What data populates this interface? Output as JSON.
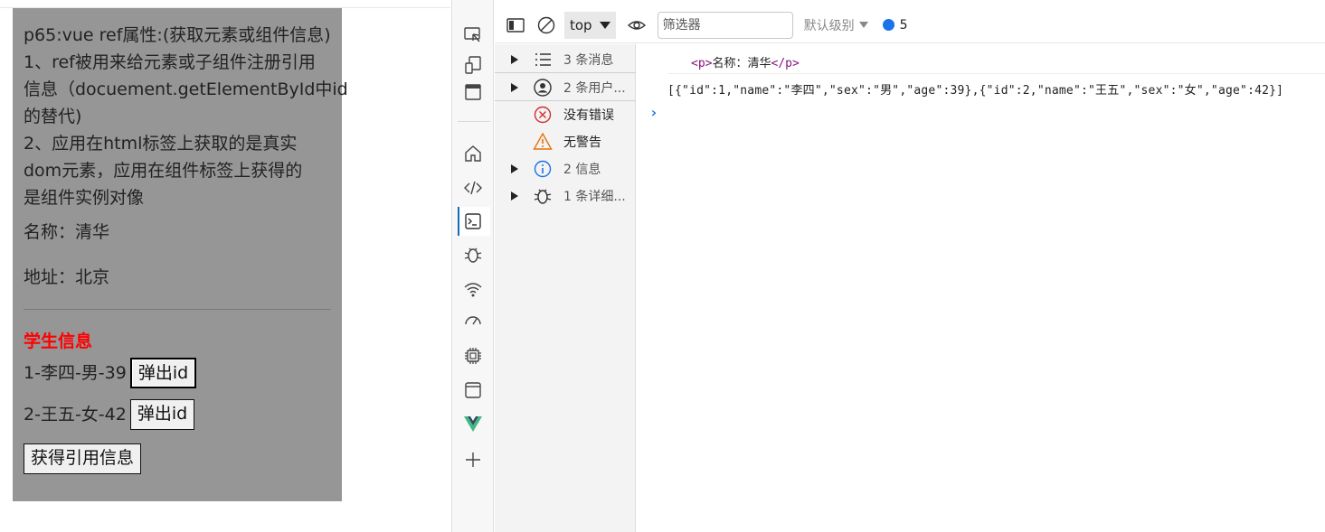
{
  "app": {
    "intro_lines": [
      "p65:vue ref属性:(获取元素或组件信息)",
      "1、ref被用来给元素或子组件注册引用",
      "信息（docuement.getElementById中id",
      "的替代)",
      "2、应用在html标签上获取的是真实",
      "dom元素，应用在组件标签上获得的",
      "是组件实例对像"
    ],
    "name_line": "名称：清华",
    "address_line": "地址：北京",
    "student_title": "学生信息",
    "students": [
      {
        "text": "1-李四-男-39",
        "button": "弹出id"
      },
      {
        "text": "2-王五-女-42",
        "button": "弹出id"
      }
    ],
    "get_ref_button": "获得引用信息"
  },
  "devtools": {
    "toolbar": {
      "context": "top",
      "filter_placeholder": "筛选器",
      "levels": "默认级别",
      "issues_count": "5"
    },
    "sidebar": [
      {
        "label": "3 条消息",
        "icon": "list-icon"
      },
      {
        "label": "2 条用户...",
        "icon": "user-icon"
      },
      {
        "label": "没有错误",
        "icon": "error-icon"
      },
      {
        "label": "无警告",
        "icon": "warning-icon"
      },
      {
        "label": "2 信息",
        "icon": "info-icon"
      },
      {
        "label": "1 条详细...",
        "icon": "bug-icon"
      }
    ],
    "console": {
      "element_open": "<p>",
      "element_text": "名称：清华",
      "element_close": "</p>",
      "json_output": "[{\"id\":1,\"name\":\"李四\",\"sex\":\"男\",\"age\":39},{\"id\":2,\"name\":\"王五\",\"sex\":\"女\",\"age\":42}]",
      "prompt": "›"
    }
  }
}
